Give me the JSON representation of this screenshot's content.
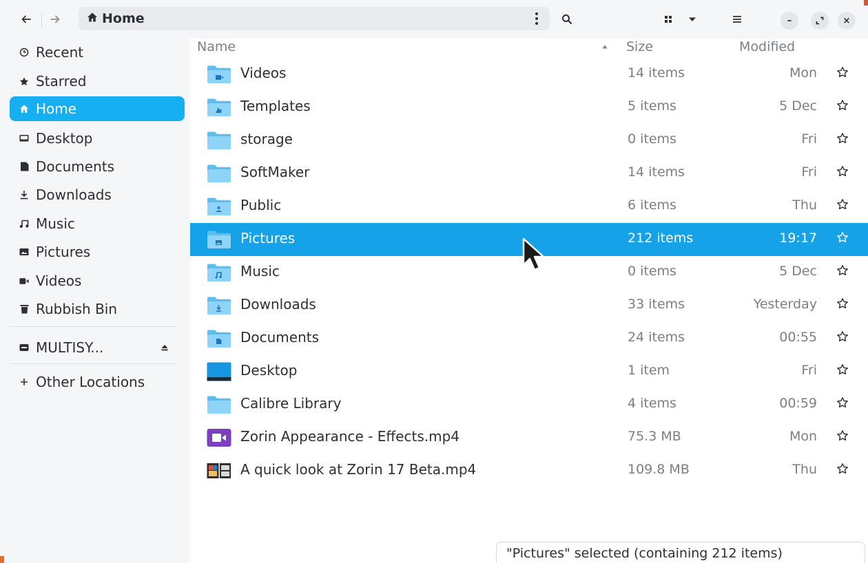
{
  "header": {
    "back_icon": "arrow-left-icon",
    "forward_icon": "arrow-right-icon",
    "path_icon": "home-icon",
    "path_label": "Home",
    "path_menu_icon": "vertical-dots-icon",
    "search_icon": "search-icon",
    "grid_icon": "grid-view-icon",
    "view_dropdown_icon": "chevron-down-icon",
    "menu_icon": "hamburger-menu-icon",
    "minimize_glyph": "–",
    "maximize_icon": "maximize-icon",
    "close_glyph": "×"
  },
  "sidebar": {
    "items": [
      {
        "label": "Recent",
        "icon": "clock-icon"
      },
      {
        "label": "Starred",
        "icon": "star-icon"
      },
      {
        "label": "Home",
        "icon": "home-icon",
        "active": true
      },
      {
        "label": "Desktop",
        "icon": "desktop-icon"
      },
      {
        "label": "Documents",
        "icon": "document-icon"
      },
      {
        "label": "Downloads",
        "icon": "download-icon"
      },
      {
        "label": "Music",
        "icon": "music-icon"
      },
      {
        "label": "Pictures",
        "icon": "pictures-icon"
      },
      {
        "label": "Videos",
        "icon": "video-icon"
      },
      {
        "label": "Rubbish Bin",
        "icon": "trash-icon"
      }
    ],
    "drive": {
      "label": "MULTISY...",
      "icon": "drive-icon",
      "eject_icon": "eject-icon"
    },
    "other": {
      "label": "Other Locations",
      "icon": "plus-icon"
    }
  },
  "list": {
    "columns": {
      "name": "Name",
      "size": "Size",
      "modified": "Modified"
    },
    "sort_indicator": "sort-ascending-icon",
    "rows": [
      {
        "name": "Videos",
        "size": "14 items",
        "modified": "Mon",
        "icon": "folder-videos-icon"
      },
      {
        "name": "Templates",
        "size": "5 items",
        "modified": "5 Dec",
        "icon": "folder-templates-icon"
      },
      {
        "name": "storage",
        "size": "0 items",
        "modified": "Fri",
        "icon": "folder-icon"
      },
      {
        "name": "SoftMaker",
        "size": "14 items",
        "modified": "Fri",
        "icon": "folder-icon"
      },
      {
        "name": "Public",
        "size": "6 items",
        "modified": "Thu",
        "icon": "folder-public-icon"
      },
      {
        "name": "Pictures",
        "size": "212 items",
        "modified": "19:17",
        "icon": "folder-pictures-icon",
        "selected": true
      },
      {
        "name": "Music",
        "size": "0 items",
        "modified": "5 Dec",
        "icon": "folder-music-icon"
      },
      {
        "name": "Downloads",
        "size": "33 items",
        "modified": "Yesterday",
        "icon": "folder-downloads-icon"
      },
      {
        "name": "Documents",
        "size": "24 items",
        "modified": "00:55",
        "icon": "folder-documents-icon"
      },
      {
        "name": "Desktop",
        "size": "1 item",
        "modified": "Fri",
        "icon": "folder-desktop-icon"
      },
      {
        "name": "Calibre Library",
        "size": "4 items",
        "modified": "00:59",
        "icon": "folder-icon"
      },
      {
        "name": "Zorin Appearance - Effects.mp4",
        "size": "75.3 MB",
        "modified": "Mon",
        "icon": "video-file-icon"
      },
      {
        "name": "A quick look at Zorin 17 Beta.mp4",
        "size": "109.8 MB",
        "modified": "Thu",
        "icon": "video-thumbnail-icon"
      }
    ]
  },
  "status": {
    "text": "\"Pictures\" selected (containing 212 items)"
  },
  "colors": {
    "accent": "#16a2e9",
    "sidebar_active": "#16b0f2",
    "folder": "#8ed3f8",
    "folder_tab": "#5bbdf0",
    "sidebar_bg": "#f5f6f7",
    "muted_text": "#7a7f87"
  }
}
